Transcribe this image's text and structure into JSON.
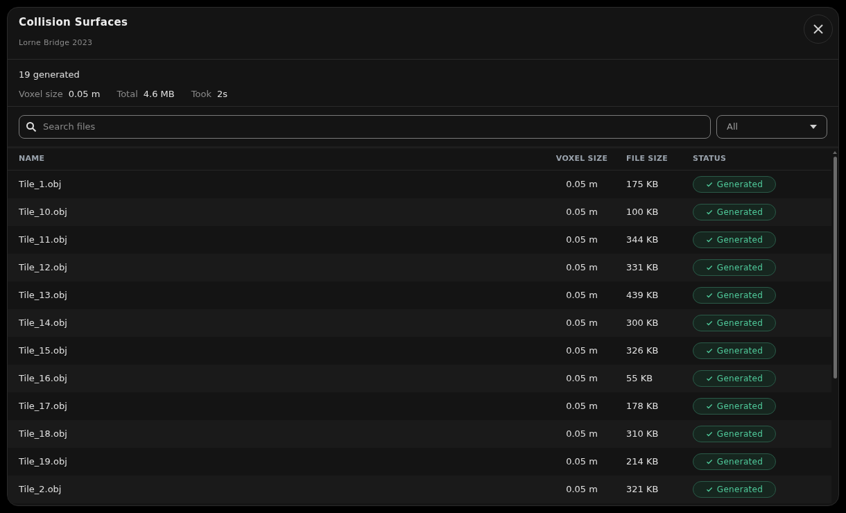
{
  "dialog": {
    "title": "Collision Surfaces",
    "subtitle": "Lorne Bridge 2023"
  },
  "summary": {
    "headline": "19 generated",
    "stats": [
      {
        "label": "Voxel size",
        "value": "0.05 m"
      },
      {
        "label": "Total",
        "value": "4.6 MB"
      },
      {
        "label": "Took",
        "value": "2s"
      }
    ]
  },
  "search": {
    "placeholder": "Search files"
  },
  "filter": {
    "value": "All"
  },
  "table": {
    "columns": [
      "NAME",
      "VOXEL SIZE",
      "FILE SIZE",
      "STATUS"
    ],
    "rows": [
      {
        "name": "Tile_1.obj",
        "voxel_size": "0.05 m",
        "file_size": "175 KB",
        "status": "Generated",
        "kind": "generated"
      },
      {
        "name": "Tile_10.obj",
        "voxel_size": "0.05 m",
        "file_size": "100 KB",
        "status": "Generated",
        "kind": "generated"
      },
      {
        "name": "Tile_11.obj",
        "voxel_size": "0.05 m",
        "file_size": "344 KB",
        "status": "Generated",
        "kind": "generated"
      },
      {
        "name": "Tile_12.obj",
        "voxel_size": "0.05 m",
        "file_size": "331 KB",
        "status": "Generated",
        "kind": "generated"
      },
      {
        "name": "Tile_13.obj",
        "voxel_size": "0.05 m",
        "file_size": "439 KB",
        "status": "Generated",
        "kind": "generated"
      },
      {
        "name": "Tile_14.obj",
        "voxel_size": "0.05 m",
        "file_size": "300 KB",
        "status": "Generated",
        "kind": "generated"
      },
      {
        "name": "Tile_15.obj",
        "voxel_size": "0.05 m",
        "file_size": "326 KB",
        "status": "Generated",
        "kind": "generated"
      },
      {
        "name": "Tile_16.obj",
        "voxel_size": "0.05 m",
        "file_size": "55 KB",
        "status": "Generated",
        "kind": "generated"
      },
      {
        "name": "Tile_17.obj",
        "voxel_size": "0.05 m",
        "file_size": "178 KB",
        "status": "Generated",
        "kind": "generated"
      },
      {
        "name": "Tile_18.obj",
        "voxel_size": "0.05 m",
        "file_size": "310 KB",
        "status": "Generated",
        "kind": "generated"
      },
      {
        "name": "Tile_19.obj",
        "voxel_size": "0.05 m",
        "file_size": "214 KB",
        "status": "Generated",
        "kind": "generated"
      },
      {
        "name": "Tile_2.obj",
        "voxel_size": "0.05 m",
        "file_size": "321 KB",
        "status": "Generated",
        "kind": "generated"
      }
    ]
  }
}
